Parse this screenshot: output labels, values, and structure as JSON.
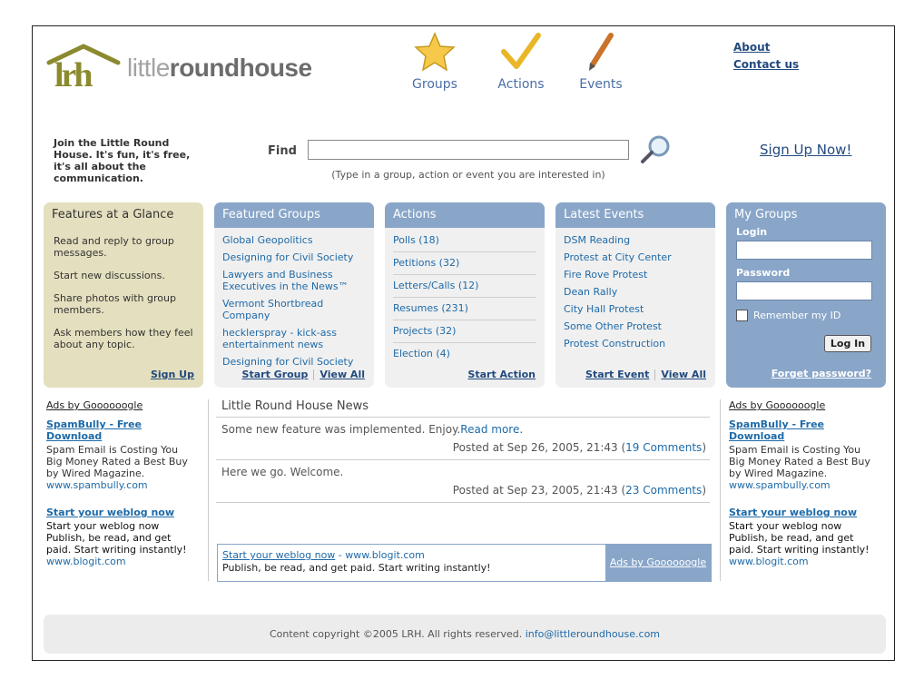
{
  "logo": {
    "light": "little",
    "bold": "round",
    "tail": "house",
    "mark": "lrh"
  },
  "nav": [
    {
      "label": "Groups",
      "icon": "star-icon"
    },
    {
      "label": "Actions",
      "icon": "checkmark-icon"
    },
    {
      "label": "Events",
      "icon": "pen-icon"
    }
  ],
  "top_links": {
    "about": "About",
    "contact": "Contact us"
  },
  "join_text": "Join the Little Round House. It's fun, it's free, it's all about the communication.",
  "search": {
    "label": "Find",
    "value": "",
    "placeholder": "",
    "hint": "(Type in a group, action or event you are interested in)"
  },
  "signup_link": "Sign Up Now!",
  "features": {
    "title": "Features at a Glance",
    "items": [
      "Read and reply to group messages.",
      "Start new discussions.",
      "Share photos with group members.",
      "Ask members how they feel about any topic."
    ],
    "link": "Sign Up"
  },
  "featured_groups": {
    "title": "Featured Groups",
    "items": [
      "Global Geopolitics",
      "Designing for Civil Society",
      "Lawyers and Business Executives in the News™",
      "Vermont Shortbread Company",
      "hecklerspray - kick-ass entertainment news",
      "Designing for Civil Society"
    ],
    "start": "Start Group",
    "view": "View All"
  },
  "actions": {
    "title": "Actions",
    "items": [
      "Polls (18)",
      "Petitions (32)",
      "Letters/Calls (12)",
      "Resumes (231)",
      "Projects (32)",
      "Election (4)"
    ],
    "start": "Start Action"
  },
  "events": {
    "title": "Latest Events",
    "items": [
      "DSM Reading",
      "Protest at City Center",
      "Fire Rove Protest",
      "Dean Rally",
      "City Hall Protest",
      "Some Other Protest",
      "Protest Construction"
    ],
    "start": "Start Event",
    "view": "View All"
  },
  "my_groups": {
    "title": "My Groups",
    "login_label": "Login",
    "password_label": "Password",
    "login_value": "",
    "password_value": "",
    "remember": "Remember my ID",
    "remember_checked": false,
    "button": "Log In",
    "forgot": "Forget password?"
  },
  "ads_left": {
    "header": "Ads by Goooooogle",
    "ads": [
      {
        "title": "SpamBully - Free Download",
        "body": "Spam Email is Costing You Big Money Rated a Best Buy by Wired Magazine.",
        "url": "www.spambully.com"
      },
      {
        "title": "Start your weblog now",
        "body": "Start your weblog now Publish, be read, and get paid. Start writing instantly!",
        "url": "www.blogit.com"
      }
    ]
  },
  "ads_right": {
    "header": "Ads by Goooooogle",
    "ads": [
      {
        "title": "SpamBully - Free Download",
        "body": "Spam Email is Costing You Big Money Rated a Best Buy by Wired Magazine.",
        "url": "www.spambully.com"
      },
      {
        "title": "Start your weblog now",
        "body": "Start your weblog now Publish, be read, and get paid. Start writing instantly!",
        "url": "www.blogit.com"
      }
    ]
  },
  "news": {
    "title": "Little Round House News",
    "items": [
      {
        "text": "Some new feature was implemented. Enjoy.",
        "more": "Read more.",
        "posted": "Posted at Sep 26, 2005, 21:43 (",
        "comments": "19 Comments",
        "close": ")"
      },
      {
        "text": "Here we go. Welcome.",
        "more": "",
        "posted": "Posted at Sep 23, 2005, 21:43 (",
        "comments": "23 Comments",
        "close": ")"
      }
    ]
  },
  "news_ad": {
    "title": "Start your weblog now",
    "sep": " - ",
    "url": "www.blogit.com",
    "body": "Publish, be read, and get paid. Start writing instantly!",
    "adsby": "Ads by Goooooogle"
  },
  "footer": {
    "text": "Content copyright ©2005 LRH. All rights reserved. ",
    "email": "info@littleroundhouse.com"
  },
  "colors": {
    "panel_header": "#89a6c9",
    "features_bg": "#e4dfbe",
    "link": "#1e6aa8",
    "logo_green": "#8b8a2e"
  }
}
